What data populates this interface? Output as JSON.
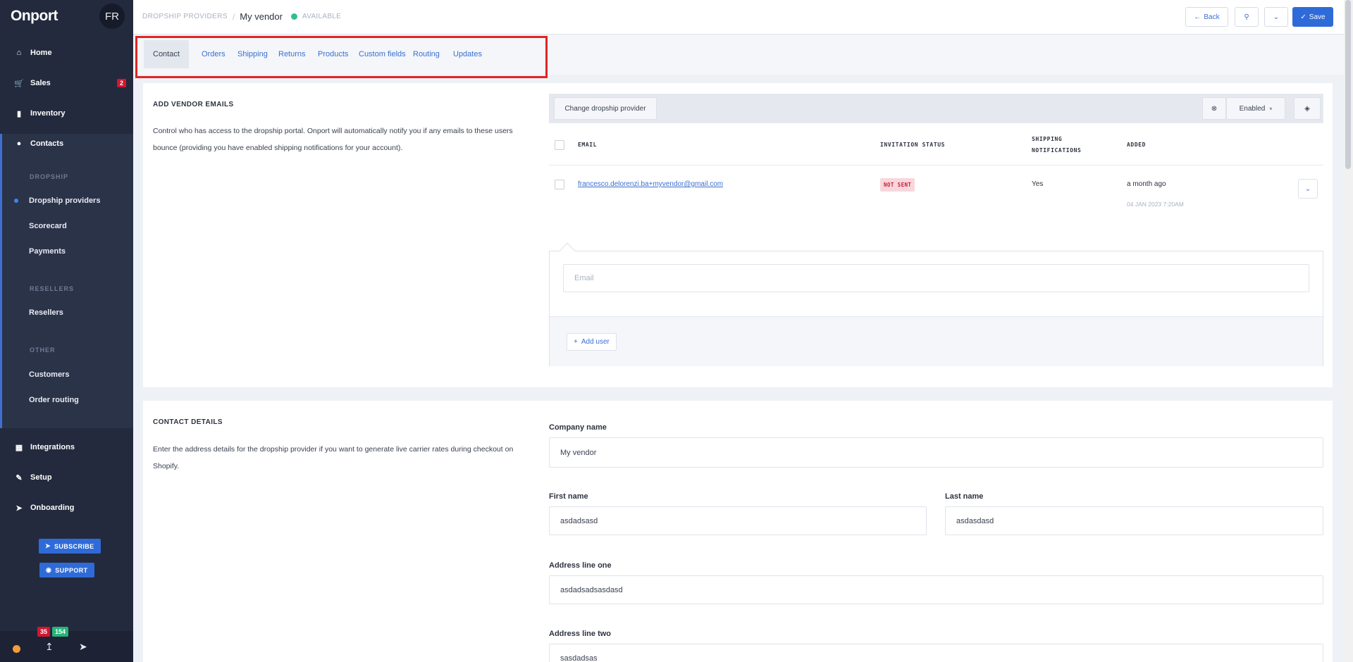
{
  "sidebar": {
    "logo": "Onport",
    "avatar": "FR",
    "items": [
      {
        "label": "Home",
        "icon": "home-icon"
      },
      {
        "label": "Sales",
        "icon": "cart-icon",
        "badge": "2"
      },
      {
        "label": "Inventory",
        "icon": "bookmark-icon"
      },
      {
        "label": "Contacts",
        "icon": "user-icon"
      },
      {
        "label": "Integrations",
        "icon": "grid-icon"
      },
      {
        "label": "Setup",
        "icon": "wrench-icon"
      },
      {
        "label": "Onboarding",
        "icon": "rocket-icon"
      }
    ],
    "sections": {
      "dropship": "DROPSHIP",
      "resellers": "RESELLERS",
      "other": "OTHER"
    },
    "sub_items": {
      "dropship_providers": "Dropship providers",
      "scorecard": "Scorecard",
      "payments": "Payments",
      "resellers": "Resellers",
      "customers": "Customers",
      "order_routing": "Order routing"
    },
    "subscribe_label": "SUBSCRIBE",
    "support_label": "SUPPORT",
    "counts": {
      "red": "35",
      "green": "154"
    }
  },
  "topbar": {
    "breadcrumb_parent": "DROPSHIP PROVIDERS",
    "breadcrumb_sep": "/",
    "title": "My vendor",
    "status": "AVAILABLE",
    "back_label": "Back",
    "save_label": "Save"
  },
  "tabs": [
    "Contact",
    "Orders",
    "Shipping",
    "Returns",
    "Products",
    "Custom fields",
    "Routing",
    "Updates"
  ],
  "vendor_emails": {
    "title": "ADD VENDOR EMAILS",
    "description": "Control who has access to the dropship portal. Onport will automatically notify you if any emails to these users bounce (providing you have enabled shipping notifications for your account).",
    "change_provider_label": "Change dropship provider",
    "enabled_label": "Enabled",
    "columns": [
      "EMAIL",
      "INVITATION STATUS",
      "SHIPPING NOTIFICATIONS",
      "ADDED"
    ],
    "rows": [
      {
        "email": "francesco.delorenzi.ba+myvendor@gmail.com",
        "status": "NOT SENT",
        "shipping": "Yes",
        "added": "a month ago",
        "added_date": "04 JAN 2023 7:20AM"
      }
    ],
    "email_placeholder": "Email",
    "add_user_label": "Add user"
  },
  "contact_details": {
    "title": "CONTACT DETAILS",
    "description": "Enter the address details for the dropship provider if you want to generate live carrier rates during checkout on Shopify.",
    "fields": {
      "company_label": "Company name",
      "company_value": "My vendor",
      "first_label": "First name",
      "first_value": "asdadsasd",
      "last_label": "Last name",
      "last_value": "asdasdasd",
      "addr1_label": "Address line one",
      "addr1_value": "asdadsadsasdasd",
      "addr2_label": "Address line two",
      "addr2_value": "sasdadsas"
    }
  },
  "colors": {
    "sidebar_bg": "#232a3d",
    "accent": "#2f6bd8",
    "highlight_box": "#e02424",
    "status_available": "#2fbf8a"
  }
}
